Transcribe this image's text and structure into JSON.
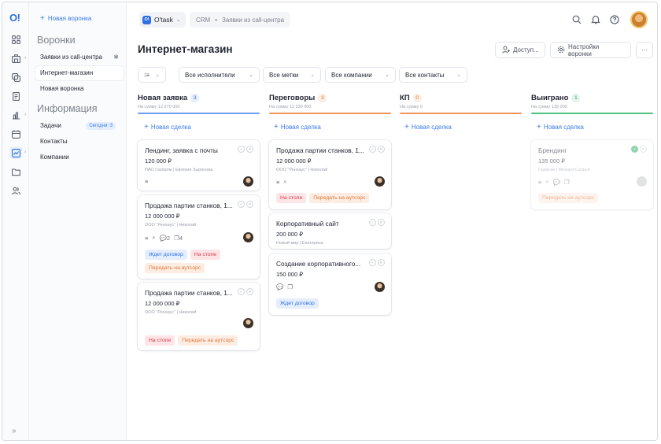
{
  "app": {
    "logo": "O!",
    "name": "O'task",
    "badge": "O!"
  },
  "breadcrumb": {
    "root": "CRM",
    "sep": "•",
    "current": "Заявки из call-центра"
  },
  "colors": {
    "accent": "#2f6fe4",
    "blue": "#6b9ef0",
    "orange": "#f0955c",
    "green": "#4ec27f"
  },
  "sidebar": {
    "new_funnel": "Новая воронка",
    "funnels_title": "Воронки",
    "funnels": [
      {
        "label": "Заявки из call-центра",
        "pinned": true
      },
      {
        "label": "Интернет-магазин",
        "active": true
      },
      {
        "label": "Новая воронка"
      }
    ],
    "info_title": "Информация",
    "info": [
      {
        "label": "Задачи",
        "badge": "Сегодня: 3"
      },
      {
        "label": "Контакты"
      },
      {
        "label": "Компании"
      }
    ],
    "collapse": "»"
  },
  "header": {
    "title": "Интернет-магазин",
    "access_label": "Доступ...",
    "settings_label": "Настройки воронки",
    "more_label": "···"
  },
  "filters": {
    "view_icon": "⁝≡",
    "executors": "Все исполнители",
    "tags": "Все метки",
    "companies": "Все компании",
    "contacts": "Все контакты"
  },
  "columns": [
    {
      "title": "Новая заявка",
      "count": "3",
      "sum": "На сумму 12 270 000",
      "new_deal": "Новая сделка",
      "cards": [
        {
          "title": "Лендинг, заявка с почты",
          "amount": "120 000 ₽",
          "meta": "ПАО Газпром | Евгения Зырянова",
          "icons": [
            "≡"
          ],
          "tags": []
        },
        {
          "title": "Продажа партии станков, 1...",
          "amount": "12 000 000 ₽",
          "meta": "ООО \"Ренхаус\" | Николай",
          "icons": [
            "≡",
            "⌕",
            "💬2",
            "❐4"
          ],
          "tags": [
            {
              "label": "Ждет договор",
              "tone": "blue"
            },
            {
              "label": "На стопе",
              "tone": "red"
            },
            {
              "label": "Передать на аутсорс",
              "tone": "orange"
            }
          ]
        },
        {
          "title": "Продажа партии станков, 1...",
          "amount": "12 000 000 ₽",
          "meta": "ООО \"Ренхаус\" | Николай",
          "icons": [],
          "tags": [
            {
              "label": "На стопе",
              "tone": "red"
            },
            {
              "label": "Передать на аутсорс",
              "tone": "orange"
            }
          ]
        }
      ]
    },
    {
      "title": "Переговоры",
      "count": "3",
      "sum": "На сумму 12 330 000",
      "new_deal": "Новая сделка",
      "cards": [
        {
          "title": "Продажа партии станков, 1...",
          "amount": "12 000 000 ₽",
          "meta": "ООО \"Ренхаус\" | Николай",
          "icons": [
            "≡",
            "⌕"
          ],
          "tags": [
            {
              "label": "На стопе",
              "tone": "red"
            },
            {
              "label": "Передать на аутсорс",
              "tone": "orange"
            }
          ]
        },
        {
          "title": "Корпоративный сайт",
          "amount": "200 000 ₽",
          "meta": "Новый мир | Екатерина",
          "icons": [],
          "tags": []
        },
        {
          "title": "Создание корпоративного...",
          "amount": "150 000 ₽",
          "meta": "",
          "icons": [
            "💬",
            "❐"
          ],
          "tags": [
            {
              "label": "Ждет договор",
              "tone": "blue"
            }
          ]
        }
      ]
    },
    {
      "title": "КП",
      "count": "0",
      "sum": "На сумму 0",
      "new_deal": "Новая сделка",
      "cards": []
    },
    {
      "title": "Выиграно",
      "count": "1",
      "sum": "На сумму 135 000",
      "new_deal": "Новая сделка",
      "cards": [
        {
          "title": "Брендинг",
          "amount": "135 000 ₽",
          "meta": "Газпром | Михаил Сапрун",
          "icons": [
            "≡",
            "⌕",
            "💬",
            "❐"
          ],
          "tags": [
            {
              "label": "Передать на аутсорс",
              "tone": "orange"
            }
          ]
        }
      ]
    }
  ]
}
